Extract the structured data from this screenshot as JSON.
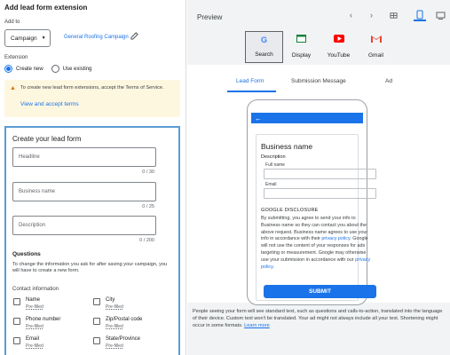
{
  "left": {
    "title": "Add lead form extension",
    "add_to_label": "Add to",
    "campaign_dropdown": "Campaign",
    "campaign_name": "General Roofing Campaign",
    "extension_label": "Extension",
    "radio_create": "Create new",
    "radio_use": "Use existing",
    "warning_text": "To create new lead form extensions, accept the Terms of Service.",
    "warning_link": "View and accept terms",
    "form_title": "Create your lead form",
    "headline_placeholder": "Headline",
    "headline_count": "0 / 30",
    "business_placeholder": "Business name",
    "business_count": "0 / 25",
    "description_placeholder": "Description",
    "description_count": "0 / 200",
    "questions_title": "Questions",
    "questions_text": "To change the information you ask for after saving your campaign, you will have to create a new form.",
    "contact_info_label": "Contact information",
    "fields": [
      {
        "name": "Name",
        "status": "Pre-filled"
      },
      {
        "name": "City",
        "status": "Pre-filled"
      },
      {
        "name": "Phone number",
        "status": "Pre-filled"
      },
      {
        "name": "Zip/Postal code",
        "status": "Pre-filled"
      },
      {
        "name": "Email",
        "status": "Pre-filled"
      },
      {
        "name": "State/Province",
        "status": "Pre-filled"
      }
    ]
  },
  "right": {
    "title": "Preview",
    "platforms": [
      {
        "label": "Search",
        "icon": "google-g-icon",
        "selected": true
      },
      {
        "label": "Display",
        "icon": "display-icon",
        "selected": false
      },
      {
        "label": "YouTube",
        "icon": "youtube-icon",
        "selected": false
      },
      {
        "label": "Gmail",
        "icon": "gmail-icon",
        "selected": false
      }
    ],
    "tabs": [
      "Lead Form",
      "Submission Message",
      "Ad"
    ],
    "phone": {
      "business_name": "Business name",
      "description": "Description",
      "full_name_label": "Full name",
      "email_label": "Email",
      "disclosure_title": "GOOGLE DISCLOSURE",
      "disclosure_1": "By submitting, you agree to send your info to Business name so they can contact you about the above request. Business name agrees to use your info in accordance with their",
      "privacy_link": "privacy policy",
      "disclosure_2": ". Google will not use the content of your responses for ads targeting or measurement. Google may otherwise use your submission in accordance with our",
      "privacy_link_2": "privacy policy",
      "disclosure_end": ".",
      "submit": "SUBMIT"
    },
    "footer_text": "People seeing your form will see standard text, such as questions and calls-to-action, translated into the language of their device. Custom text won't be translated. Your ad might not always include all your text. Shortening might occur in some formats.",
    "footer_link": "Learn more"
  },
  "colors": {
    "accent": "#1a73e8",
    "warning_bg": "#fef7e0",
    "panel_bg": "#f1f3f4"
  }
}
